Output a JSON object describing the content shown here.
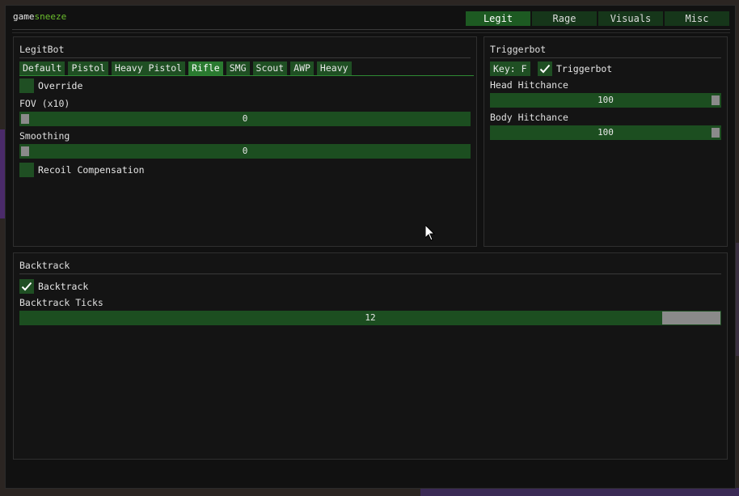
{
  "app": {
    "title_left": "game",
    "title_right": "sneeze"
  },
  "colors": {
    "accent": "#6cbf2e",
    "panel_bg": "#141414",
    "control_green": "#1f4f23",
    "control_active": "#2a7a30"
  },
  "tabs": [
    {
      "label": "Legit",
      "active": true
    },
    {
      "label": "Rage",
      "active": false
    },
    {
      "label": "Visuals",
      "active": false
    },
    {
      "label": "Misc",
      "active": false
    }
  ],
  "legitbot": {
    "title": "LegitBot",
    "weapon_tabs": [
      {
        "label": "Default",
        "active": false
      },
      {
        "label": "Pistol",
        "active": false
      },
      {
        "label": "Heavy Pistol",
        "active": false
      },
      {
        "label": "Rifle",
        "active": true
      },
      {
        "label": "SMG",
        "active": false
      },
      {
        "label": "Scout",
        "active": false
      },
      {
        "label": "AWP",
        "active": false
      },
      {
        "label": "Heavy",
        "active": false
      }
    ],
    "override": {
      "label": "Override",
      "checked": false
    },
    "fov": {
      "label": "FOV (x10)",
      "value": "0",
      "fraction": 0
    },
    "smoothing": {
      "label": "Smoothing",
      "value": "0",
      "fraction": 0
    },
    "recoil": {
      "label": "Recoil Compensation",
      "checked": false
    }
  },
  "triggerbot": {
    "title": "Triggerbot",
    "key_label": "Key: F",
    "enabled": {
      "label": "Triggerbot",
      "checked": true
    },
    "head_hitchance": {
      "label": "Head Hitchance",
      "value": "100",
      "fraction": 1
    },
    "body_hitchance": {
      "label": "Body Hitchance",
      "value": "100",
      "fraction": 1
    }
  },
  "backtrack": {
    "title": "Backtrack",
    "enabled": {
      "label": "Backtrack",
      "checked": true
    },
    "ticks": {
      "label": "Backtrack Ticks",
      "value": "12",
      "fraction": 0.92
    }
  }
}
